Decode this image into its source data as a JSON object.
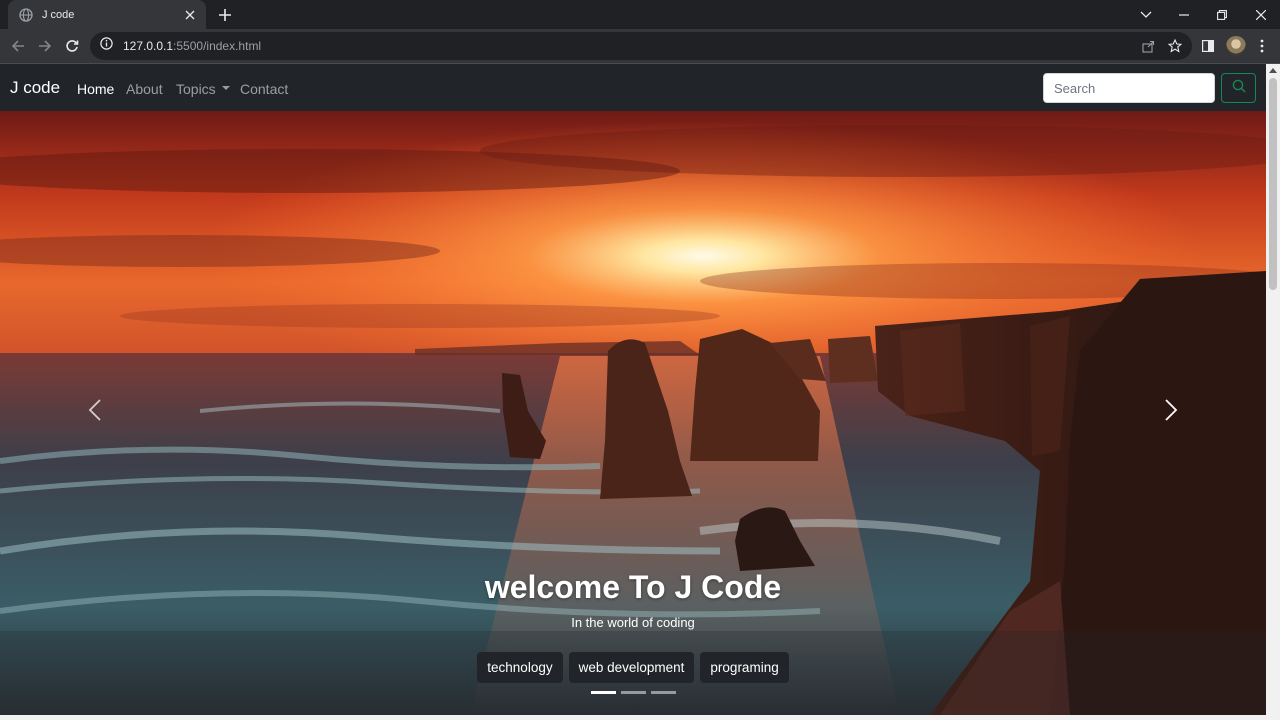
{
  "browser": {
    "tab_title": "J code",
    "url_host": "127.0.0.1",
    "url_path": ":5500/index.html"
  },
  "navbar": {
    "brand": "J code",
    "links": [
      "Home",
      "About",
      "Topics",
      "Contact"
    ],
    "active_link": "Home",
    "search_placeholder": "Search",
    "search_button_color": "#198754"
  },
  "carousel": {
    "heading": "welcome To J Code",
    "subheading": "In the world of coding",
    "chips": [
      "technology",
      "web development",
      "programing"
    ],
    "slide_count": 3,
    "active_slide": 1
  },
  "icons": {
    "tab_favicon": "globe-icon",
    "prev": "chevron-left-icon",
    "next": "chevron-right-icon",
    "search": "search-icon"
  }
}
